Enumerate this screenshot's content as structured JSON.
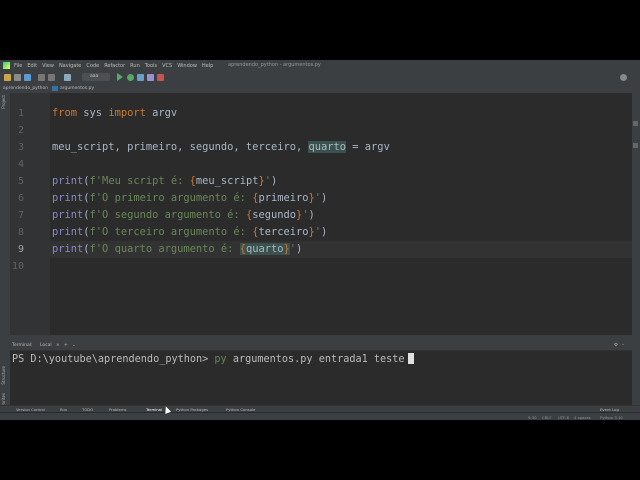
{
  "menu": [
    "File",
    "Edit",
    "View",
    "Navigate",
    "Code",
    "Refactor",
    "Run",
    "Tools",
    "VCS",
    "Window",
    "Help"
  ],
  "window_title": "aprendendo_python - argumentos.py",
  "toolbar": {
    "run_config": "aaa"
  },
  "breadcrumb": {
    "project": "aprendendo_python",
    "file": "argumentos.py"
  },
  "left_tools": {
    "project": "Project",
    "structure": "Structure",
    "favorites": "Favorites"
  },
  "editor": {
    "line_numbers": [
      "1",
      "2",
      "3",
      "4",
      "5",
      "6",
      "7",
      "8",
      "9",
      "10"
    ],
    "active_line": 9,
    "lines": [
      {
        "kw1": "from",
        "rest1": " sys ",
        "kw2": "import",
        "rest2": " argv"
      },
      {},
      {
        "text": "meu_script, primeiro, segundo, terceiro, ",
        "hl": "quarto",
        "rest": " = argv"
      },
      {},
      {
        "fn": "print",
        "open": "(",
        "s1": "f'Meu script é: ",
        "b1": "{",
        "v": "meu_script",
        "b2": "}",
        "s2": "'",
        "close": ")"
      },
      {
        "fn": "print",
        "open": "(",
        "s1": "f'O primeiro argumento é: ",
        "b1": "{",
        "v": "primeiro",
        "b2": "}",
        "s2": "'",
        "close": ")"
      },
      {
        "fn": "print",
        "open": "(",
        "s1": "f'O segundo argumento é: ",
        "b1": "{",
        "v": "segundo",
        "b2": "}",
        "s2": "'",
        "close": ")"
      },
      {
        "fn": "print",
        "open": "(",
        "s1": "f'O terceiro argumento é: ",
        "b1": "{",
        "v": "terceiro",
        "b2": "}",
        "s2": "'",
        "close": ")"
      },
      {
        "fn": "print",
        "open": "(",
        "s1": "f'O quarto argumento é: ",
        "b1": "{",
        "v": "quarto",
        "b2": "}",
        "s2": "'",
        "close": ")"
      }
    ]
  },
  "terminal": {
    "tab_label": "Terminal:",
    "local_tab": "Local",
    "prompt": "PS D:\\youtube\\aprendendo_python> ",
    "cmd": "py",
    "args": " argumentos.py entrada1 teste"
  },
  "bottom_tabs": [
    "Version Control",
    "Run",
    "TODO",
    "Problems",
    "Terminal",
    "Python Packages",
    "Python Console"
  ],
  "event_log": "Event Log",
  "status": {
    "position": "9:30",
    "line_sep": "CRLF",
    "encoding": "UTF-8",
    "indent": "4 spaces",
    "interpreter": "Python 3.10"
  },
  "colors": {
    "bg": "#2b2b2b",
    "panel": "#3c3f41",
    "keyword": "#cc7832",
    "string": "#6a8759",
    "builtin": "#8888c6",
    "text": "#a9b7c6"
  }
}
